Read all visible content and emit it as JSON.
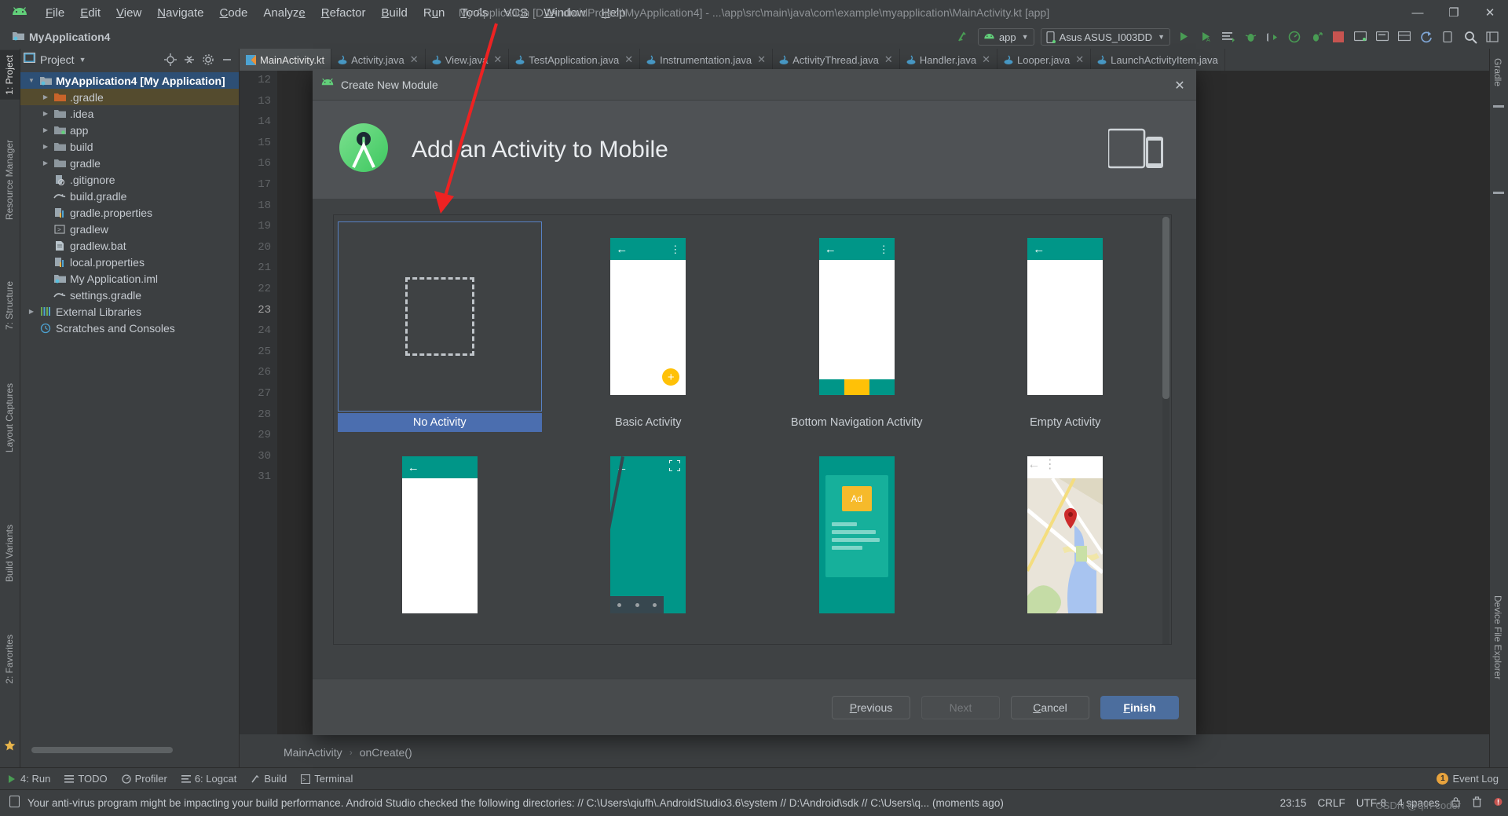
{
  "window": {
    "title": "My Application [D:\\AndroidProject\\MyApplication4] - ...\\app\\src\\main\\java\\com\\example\\myapplication\\MainActivity.kt [app]",
    "minimize": "—",
    "maximize": "❐",
    "close": "✕"
  },
  "menu": {
    "items": [
      {
        "pre": "",
        "mn": "F",
        "post": "ile"
      },
      {
        "pre": "",
        "mn": "E",
        "post": "dit"
      },
      {
        "pre": "",
        "mn": "V",
        "post": "iew"
      },
      {
        "pre": "",
        "mn": "N",
        "post": "avigate"
      },
      {
        "pre": "",
        "mn": "C",
        "post": "ode"
      },
      {
        "pre": "Analyz",
        "mn": "e",
        "post": ""
      },
      {
        "pre": "",
        "mn": "R",
        "post": "efactor"
      },
      {
        "pre": "",
        "mn": "B",
        "post": "uild"
      },
      {
        "pre": "R",
        "mn": "u",
        "post": "n"
      },
      {
        "pre": "",
        "mn": "T",
        "post": "ools"
      },
      {
        "pre": "VC",
        "mn": "S",
        "post": ""
      },
      {
        "pre": "",
        "mn": "W",
        "post": "indow"
      },
      {
        "pre": "",
        "mn": "H",
        "post": "elp"
      }
    ]
  },
  "navbar": {
    "project_crumb": "MyApplication4",
    "run_config": "app",
    "device": "Asus ASUS_I003DD"
  },
  "left_tabs": [
    {
      "label": "1: Project",
      "active": true
    },
    {
      "label": "Resource Manager",
      "active": false
    },
    {
      "label": "7: Structure",
      "active": false
    },
    {
      "label": "Layout Captures",
      "active": false
    },
    {
      "label": "Build Variants",
      "active": false
    },
    {
      "label": "2: Favorites",
      "active": false
    }
  ],
  "right_tabs": [
    {
      "label": "Gradle"
    },
    {
      "label": "Device File Explorer"
    }
  ],
  "project_panel": {
    "title": "Project",
    "tree": [
      {
        "label": "MyApplication4 [My Application]",
        "indent": 0,
        "arrow": "▼",
        "icon": "module-folder",
        "state": "selected-root"
      },
      {
        "label": ".gradle",
        "indent": 1,
        "arrow": "▶",
        "icon": "folder-orange",
        "state": "highlight"
      },
      {
        "label": ".idea",
        "indent": 1,
        "arrow": "▶",
        "icon": "folder",
        "state": ""
      },
      {
        "label": "app",
        "indent": 1,
        "arrow": "▶",
        "icon": "folder-module",
        "state": ""
      },
      {
        "label": "build",
        "indent": 1,
        "arrow": "▶",
        "icon": "folder",
        "state": ""
      },
      {
        "label": "gradle",
        "indent": 1,
        "arrow": "▶",
        "icon": "folder",
        "state": ""
      },
      {
        "label": ".gitignore",
        "indent": 2,
        "arrow": "",
        "icon": "gitignore-file",
        "state": ""
      },
      {
        "label": "build.gradle",
        "indent": 2,
        "arrow": "",
        "icon": "gradle-file",
        "state": ""
      },
      {
        "label": "gradle.properties",
        "indent": 2,
        "arrow": "",
        "icon": "properties-file",
        "state": ""
      },
      {
        "label": "gradlew",
        "indent": 2,
        "arrow": "",
        "icon": "script-file",
        "state": ""
      },
      {
        "label": "gradlew.bat",
        "indent": 2,
        "arrow": "",
        "icon": "bat-file",
        "state": ""
      },
      {
        "label": "local.properties",
        "indent": 2,
        "arrow": "",
        "icon": "properties-file",
        "state": ""
      },
      {
        "label": "My Application.iml",
        "indent": 2,
        "arrow": "",
        "icon": "iml-file",
        "state": ""
      },
      {
        "label": "settings.gradle",
        "indent": 2,
        "arrow": "",
        "icon": "gradle-file",
        "state": ""
      },
      {
        "label": "External Libraries",
        "indent": 0,
        "arrow": "▶",
        "icon": "libraries",
        "state": ""
      },
      {
        "label": "Scratches and Consoles",
        "indent": 0,
        "arrow": "",
        "icon": "scratches",
        "state": ""
      }
    ]
  },
  "editor_tabs": [
    {
      "label": "MainActivity.kt",
      "active": true
    },
    {
      "label": "Activity.java",
      "active": false
    },
    {
      "label": "View.java",
      "active": false
    },
    {
      "label": "TestApplication.java",
      "active": false
    },
    {
      "label": "Instrumentation.java",
      "active": false
    },
    {
      "label": "ActivityThread.java",
      "active": false
    },
    {
      "label": "Handler.java",
      "active": false
    },
    {
      "label": "Looper.java",
      "active": false
    },
    {
      "label": "LaunchActivityItem.java",
      "active": false
    }
  ],
  "gutter_lines": [
    "12",
    "13",
    "14",
    "15",
    "16",
    "17",
    "18",
    "19",
    "20",
    "21",
    "22",
    "23",
    "24",
    "25",
    "26",
    "27",
    "28",
    "29",
    "30",
    "31"
  ],
  "gutter_current": "23",
  "editor_breadcrumb": {
    "class": "MainActivity",
    "separator": "›",
    "method": "onCreate()"
  },
  "dialog": {
    "title": "Create New Module",
    "heading": "Add an Activity to Mobile",
    "close_label": "✕",
    "templates": [
      {
        "label": "No Activity",
        "thumb": "no-activity",
        "selected": true
      },
      {
        "label": "Basic Activity",
        "thumb": "basic-activity",
        "selected": false
      },
      {
        "label": "Bottom Navigation Activity",
        "thumb": "bottom-navigation-activity",
        "selected": false
      },
      {
        "label": "Empty Activity",
        "thumb": "empty-activity",
        "selected": false
      },
      {
        "label": "",
        "thumb": "fullscreen-plain",
        "selected": false
      },
      {
        "label": "",
        "thumb": "fullscreen-activity",
        "selected": false
      },
      {
        "label": "",
        "thumb": "ads-activity",
        "selected": false
      },
      {
        "label": "",
        "thumb": "maps-activity",
        "selected": false
      }
    ],
    "buttons": {
      "previous": {
        "pre": "",
        "mn": "P",
        "post": "revious",
        "state": "enabled"
      },
      "next": {
        "pre": "",
        "mn": "N",
        "post": "ext",
        "state": "disabled"
      },
      "cancel": {
        "pre": "",
        "mn": "C",
        "post": "ancel",
        "state": "enabled"
      },
      "finish": {
        "pre": "",
        "mn": "F",
        "post": "inish",
        "state": "primary"
      }
    }
  },
  "bottom_tools": [
    {
      "label": "4: Run",
      "icon": "run-icon"
    },
    {
      "label": "TODO",
      "icon": "todo-icon"
    },
    {
      "label": "Profiler",
      "icon": "profiler-icon"
    },
    {
      "label": "6: Logcat",
      "icon": "logcat-icon"
    },
    {
      "label": "Build",
      "icon": "build-icon"
    },
    {
      "label": "Terminal",
      "icon": "terminal-icon"
    }
  ],
  "event_log": {
    "label": "Event Log",
    "count": "1"
  },
  "status": {
    "message": "Your anti-virus program might be impacting your build performance. Android Studio checked the following directories: // C:\\Users\\qiufh\\.AndroidStudio3.6\\system // D:\\Android\\sdk // C:\\Users\\q... (moments ago)",
    "caret": "23:15",
    "line_ending": "CRLF",
    "encoding": "UTF-8",
    "indent": "4 spaces",
    "watermark": "CSDN @qfh-coder"
  },
  "colors": {
    "accent_blue": "#4b6eaf",
    "selection_blue": "#2d4f75",
    "teal": "#009688",
    "amber": "#ffc107",
    "annotation_red": "#ee2222",
    "panel_bg": "#3c3f41",
    "editor_bg": "#2b2b2b",
    "dialog_bg": "#3f4244"
  }
}
